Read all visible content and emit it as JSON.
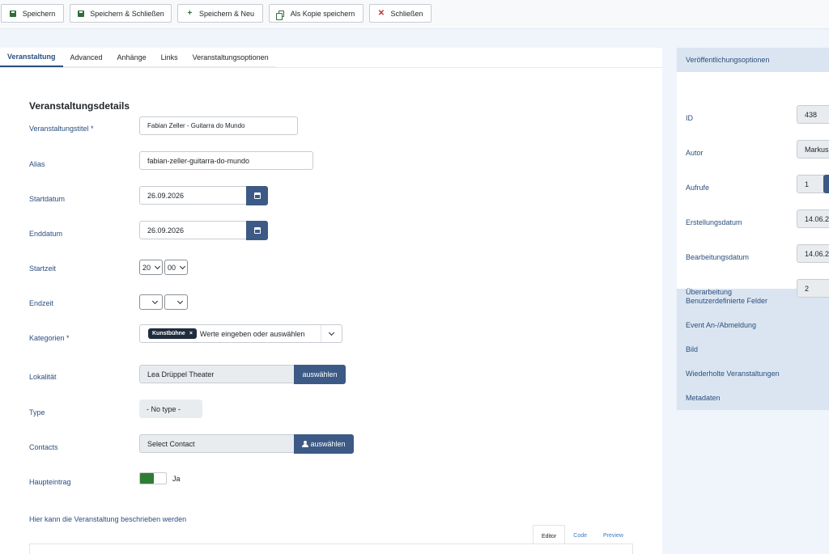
{
  "toolbar": {
    "save": "Speichern",
    "save_close": "Speichern & Schließen",
    "save_new": "Speichern & Neu",
    "save_copy": "Als Kopie speichern",
    "close": "Schließen"
  },
  "tabs": [
    "Veranstaltung",
    "Advanced",
    "Anhänge",
    "Links",
    "Veranstaltungsoptionen"
  ],
  "details": {
    "title": "Veranstaltungsdetails",
    "event_title_label": "Veranstaltungstitel *",
    "event_title_value": "Fabian Zeller - Guitarra do Mundo",
    "alias_label": "Alias",
    "alias_value": "fabian-zeller-guitarra-do-mundo",
    "start_date_label": "Startdatum",
    "start_date_value": "26.09.2026",
    "end_date_label": "Enddatum",
    "end_date_value": "26.09.2026",
    "start_time_label": "Startzeit",
    "start_hour": "20",
    "start_minute": "00",
    "end_time_label": "Endzeit",
    "end_hour": "",
    "end_minute": "",
    "categories_label": "Kategorien *",
    "category_chip": "Kunstbühne",
    "chip_remove": "×",
    "categories_placeholder": "Werte eingeben oder auswählen",
    "venue_label": "Lokalität",
    "venue_value": "Lea Drüppel Theater",
    "select_button": "auswählen",
    "type_label": "Type",
    "type_value": "- No type -",
    "contacts_label": "Contacts",
    "contacts_value": "Select Contact",
    "contacts_button": "auswählen",
    "featured_label": "Haupteintrag",
    "featured_value": "Ja",
    "description_label": "Hier kann die Veranstaltung beschrieben werden"
  },
  "editor_tabs": [
    "Editor",
    "Code",
    "Preview"
  ],
  "side": {
    "header": "Veröffentlichungsoptionen",
    "id_label": "ID",
    "id_value": "438",
    "author_label": "Autor",
    "author_value": "Markus",
    "hits_label": "Aufrufe",
    "hits_value": "1",
    "created_label": "Erstellungsdatum",
    "created_value": "14.06.2",
    "modified_label": "Bearbeitungsdatum",
    "modified_value": "14.06.2",
    "revision_label": "Überarbeitung",
    "revision_value": "2",
    "accordion": [
      "Benutzerdefinierte Felder",
      "Event An-/Abmeldung",
      "Bild",
      "Wiederholte Veranstaltungen",
      "Metadaten"
    ]
  }
}
